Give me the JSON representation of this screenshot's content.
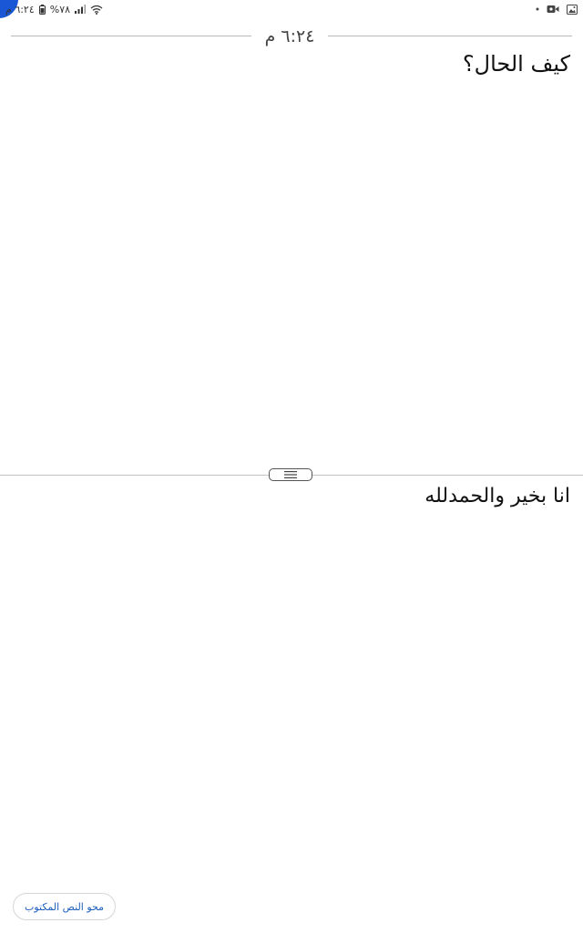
{
  "status_bar": {
    "time": "٦:٢٤ م",
    "battery": "%٧٨",
    "icons": [
      "wifi-icon",
      "signal-icon",
      "battery-icon",
      "gallery-icon",
      "video-icon",
      "dot-icon"
    ]
  },
  "conversation": {
    "timestamp": "٦:٢٤ م",
    "top_text": "كيف الحال؟",
    "bottom_text": "انا بخير والحمدلله"
  },
  "actions": {
    "clear_label": "محو النص المكتوب"
  },
  "colors": {
    "accent": "#1a57d6",
    "button_text": "#1f5fbf",
    "divider": "#c2c2c2"
  }
}
